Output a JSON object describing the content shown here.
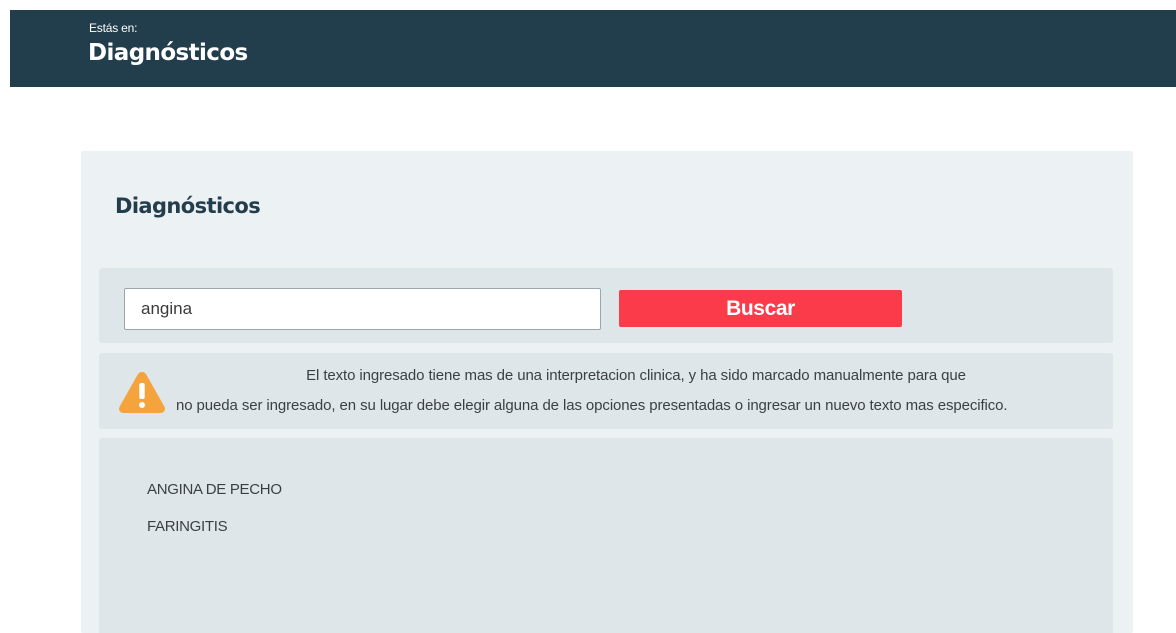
{
  "header": {
    "breadcrumb_prefix": "Estás en:",
    "breadcrumb_title": "Diagnósticos"
  },
  "panel": {
    "title": "Diagnósticos"
  },
  "search": {
    "value": "angina",
    "button_label": "Buscar"
  },
  "warning": {
    "icon": "warning-triangle-icon",
    "line1": "El texto ingresado tiene mas de una interpretacion clinica, y ha sido marcado manualmente para que",
    "line2": "no pueda ser ingresado, en su lugar debe elegir alguna de las opciones presentadas o ingresar un nuevo texto mas especifico."
  },
  "results": {
    "items": [
      {
        "label": "ANGINA DE PECHO"
      },
      {
        "label": "FARINGITIS"
      }
    ]
  },
  "colors": {
    "header_bg": "#223d4b",
    "panel_bg": "#ecf1f4",
    "box_bg": "#dfe6ea",
    "button_bg": "#fb3a4a",
    "warning_icon": "#f5a33c"
  }
}
